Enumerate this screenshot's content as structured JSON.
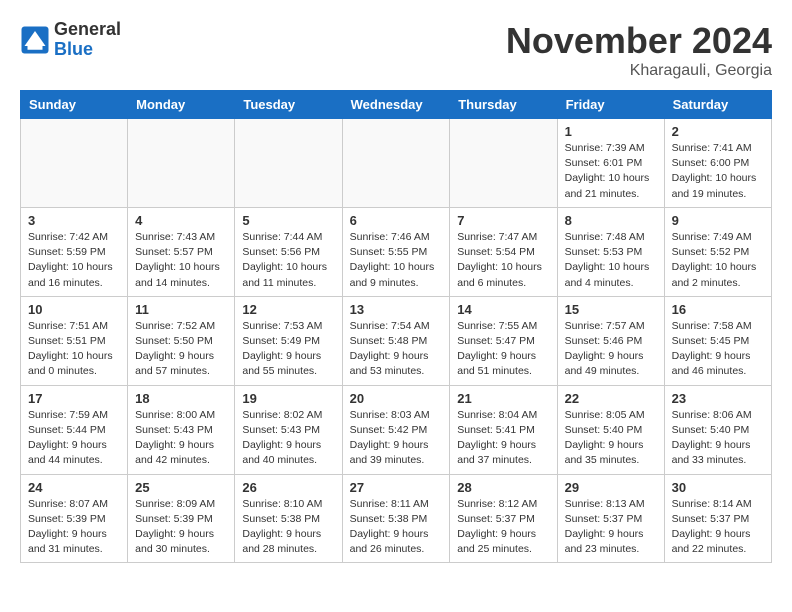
{
  "header": {
    "logo_general": "General",
    "logo_blue": "Blue",
    "month_title": "November 2024",
    "location": "Kharagauli, Georgia"
  },
  "weekdays": [
    "Sunday",
    "Monday",
    "Tuesday",
    "Wednesday",
    "Thursday",
    "Friday",
    "Saturday"
  ],
  "weeks": [
    [
      {
        "day": "",
        "info": ""
      },
      {
        "day": "",
        "info": ""
      },
      {
        "day": "",
        "info": ""
      },
      {
        "day": "",
        "info": ""
      },
      {
        "day": "",
        "info": ""
      },
      {
        "day": "1",
        "info": "Sunrise: 7:39 AM\nSunset: 6:01 PM\nDaylight: 10 hours and 21 minutes."
      },
      {
        "day": "2",
        "info": "Sunrise: 7:41 AM\nSunset: 6:00 PM\nDaylight: 10 hours and 19 minutes."
      }
    ],
    [
      {
        "day": "3",
        "info": "Sunrise: 7:42 AM\nSunset: 5:59 PM\nDaylight: 10 hours and 16 minutes."
      },
      {
        "day": "4",
        "info": "Sunrise: 7:43 AM\nSunset: 5:57 PM\nDaylight: 10 hours and 14 minutes."
      },
      {
        "day": "5",
        "info": "Sunrise: 7:44 AM\nSunset: 5:56 PM\nDaylight: 10 hours and 11 minutes."
      },
      {
        "day": "6",
        "info": "Sunrise: 7:46 AM\nSunset: 5:55 PM\nDaylight: 10 hours and 9 minutes."
      },
      {
        "day": "7",
        "info": "Sunrise: 7:47 AM\nSunset: 5:54 PM\nDaylight: 10 hours and 6 minutes."
      },
      {
        "day": "8",
        "info": "Sunrise: 7:48 AM\nSunset: 5:53 PM\nDaylight: 10 hours and 4 minutes."
      },
      {
        "day": "9",
        "info": "Sunrise: 7:49 AM\nSunset: 5:52 PM\nDaylight: 10 hours and 2 minutes."
      }
    ],
    [
      {
        "day": "10",
        "info": "Sunrise: 7:51 AM\nSunset: 5:51 PM\nDaylight: 10 hours and 0 minutes."
      },
      {
        "day": "11",
        "info": "Sunrise: 7:52 AM\nSunset: 5:50 PM\nDaylight: 9 hours and 57 minutes."
      },
      {
        "day": "12",
        "info": "Sunrise: 7:53 AM\nSunset: 5:49 PM\nDaylight: 9 hours and 55 minutes."
      },
      {
        "day": "13",
        "info": "Sunrise: 7:54 AM\nSunset: 5:48 PM\nDaylight: 9 hours and 53 minutes."
      },
      {
        "day": "14",
        "info": "Sunrise: 7:55 AM\nSunset: 5:47 PM\nDaylight: 9 hours and 51 minutes."
      },
      {
        "day": "15",
        "info": "Sunrise: 7:57 AM\nSunset: 5:46 PM\nDaylight: 9 hours and 49 minutes."
      },
      {
        "day": "16",
        "info": "Sunrise: 7:58 AM\nSunset: 5:45 PM\nDaylight: 9 hours and 46 minutes."
      }
    ],
    [
      {
        "day": "17",
        "info": "Sunrise: 7:59 AM\nSunset: 5:44 PM\nDaylight: 9 hours and 44 minutes."
      },
      {
        "day": "18",
        "info": "Sunrise: 8:00 AM\nSunset: 5:43 PM\nDaylight: 9 hours and 42 minutes."
      },
      {
        "day": "19",
        "info": "Sunrise: 8:02 AM\nSunset: 5:43 PM\nDaylight: 9 hours and 40 minutes."
      },
      {
        "day": "20",
        "info": "Sunrise: 8:03 AM\nSunset: 5:42 PM\nDaylight: 9 hours and 39 minutes."
      },
      {
        "day": "21",
        "info": "Sunrise: 8:04 AM\nSunset: 5:41 PM\nDaylight: 9 hours and 37 minutes."
      },
      {
        "day": "22",
        "info": "Sunrise: 8:05 AM\nSunset: 5:40 PM\nDaylight: 9 hours and 35 minutes."
      },
      {
        "day": "23",
        "info": "Sunrise: 8:06 AM\nSunset: 5:40 PM\nDaylight: 9 hours and 33 minutes."
      }
    ],
    [
      {
        "day": "24",
        "info": "Sunrise: 8:07 AM\nSunset: 5:39 PM\nDaylight: 9 hours and 31 minutes."
      },
      {
        "day": "25",
        "info": "Sunrise: 8:09 AM\nSunset: 5:39 PM\nDaylight: 9 hours and 30 minutes."
      },
      {
        "day": "26",
        "info": "Sunrise: 8:10 AM\nSunset: 5:38 PM\nDaylight: 9 hours and 28 minutes."
      },
      {
        "day": "27",
        "info": "Sunrise: 8:11 AM\nSunset: 5:38 PM\nDaylight: 9 hours and 26 minutes."
      },
      {
        "day": "28",
        "info": "Sunrise: 8:12 AM\nSunset: 5:37 PM\nDaylight: 9 hours and 25 minutes."
      },
      {
        "day": "29",
        "info": "Sunrise: 8:13 AM\nSunset: 5:37 PM\nDaylight: 9 hours and 23 minutes."
      },
      {
        "day": "30",
        "info": "Sunrise: 8:14 AM\nSunset: 5:37 PM\nDaylight: 9 hours and 22 minutes."
      }
    ]
  ]
}
